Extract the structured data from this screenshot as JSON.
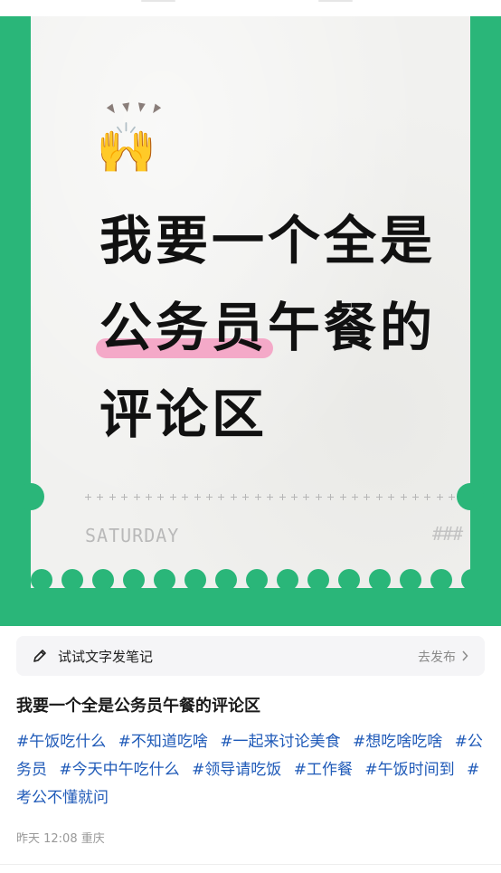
{
  "cover": {
    "emoji": "🙌",
    "headline_lines": [
      "我要一个全是",
      "公务员",
      "午餐的",
      "评论区"
    ],
    "footer_word": "SATURDAY",
    "footer_hash": "###",
    "colors": {
      "green": "#2ab679",
      "paper": "#f1f1ef",
      "highlight": "#f4a9c8"
    }
  },
  "note_bar": {
    "label": "试试文字发笔记",
    "publish": "去发布",
    "icon": "pencil-icon",
    "chevron": "chevron-right-icon"
  },
  "post": {
    "title": "我要一个全是公务员午餐的评论区",
    "tags": [
      "#午饭吃什么",
      "#不知道吃啥",
      "#一起来讨论美食",
      "#想吃啥吃啥",
      "#公务员",
      "#今天中午吃什么",
      "#领导请吃饭",
      "#工作餐",
      "#午饭时间到",
      "#考公不懂就问"
    ],
    "meta": "昨天 12:08 重庆",
    "tag_color": "#1f5ab8"
  }
}
